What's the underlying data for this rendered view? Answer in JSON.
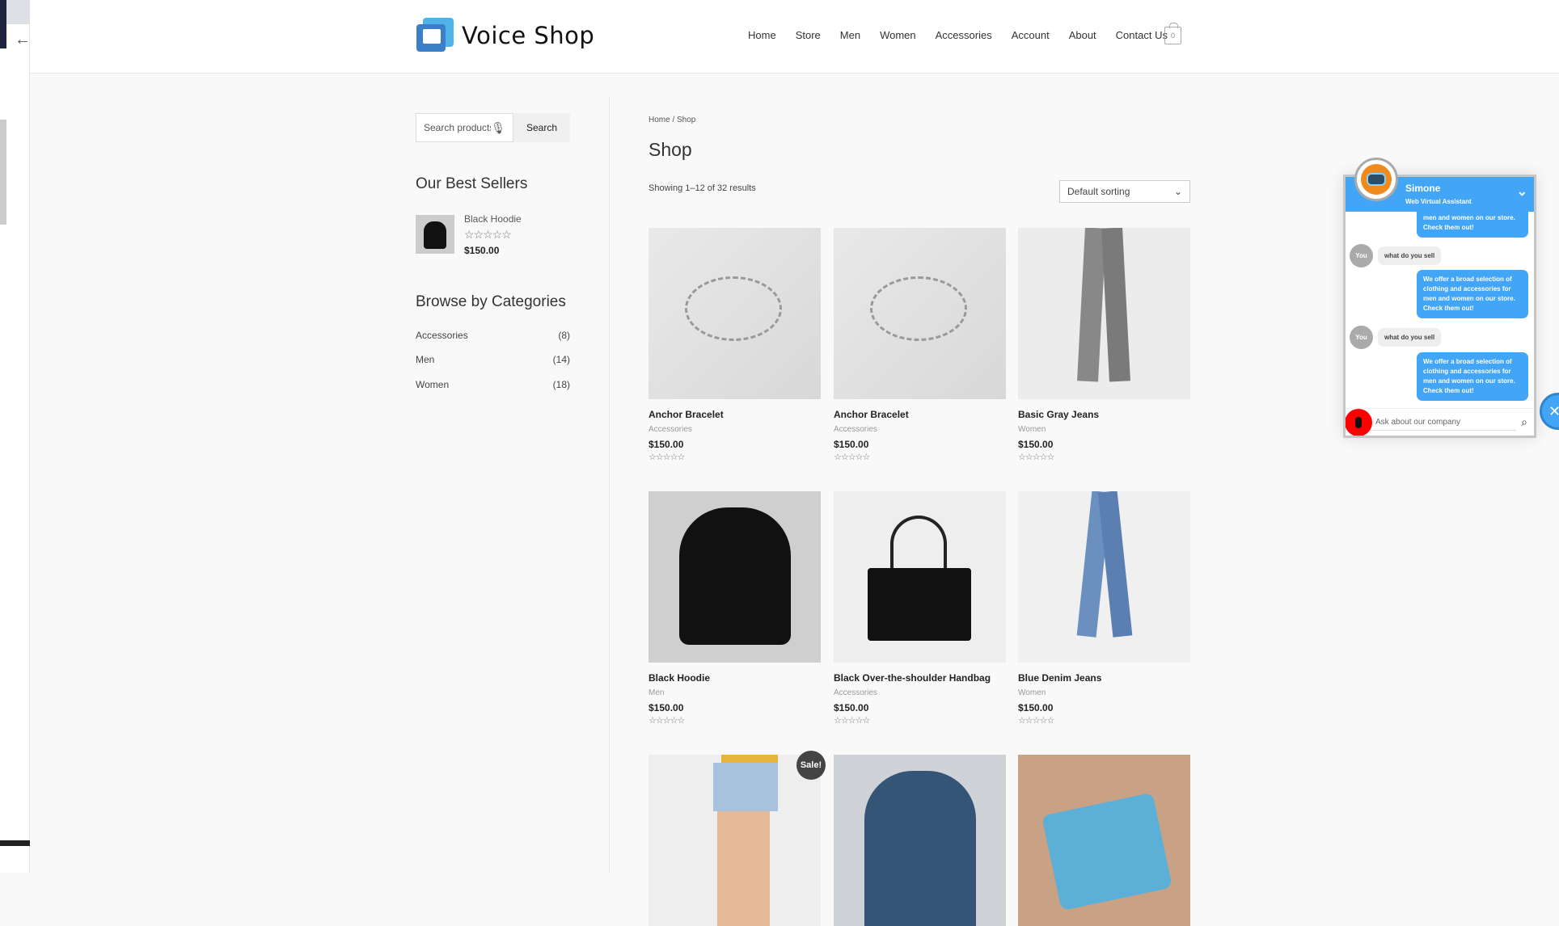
{
  "brand": {
    "name": "Voice Shop",
    "accent": "#42a5f5"
  },
  "nav": [
    "Home",
    "Store",
    "Men",
    "Women",
    "Accessories",
    "Account",
    "About",
    "Contact Us"
  ],
  "cart": {
    "count": "0"
  },
  "sidebar": {
    "search": {
      "placeholder": "Search products",
      "button": "Search"
    },
    "best_sellers_title": "Our Best Sellers",
    "best_seller": {
      "name": "Black Hoodie",
      "price": "$150.00",
      "rating": 0
    },
    "categories_title": "Browse by Categories",
    "categories": [
      {
        "name": "Accessories",
        "count": "(8)"
      },
      {
        "name": "Men",
        "count": "(14)"
      },
      {
        "name": "Women",
        "count": "(18)"
      }
    ]
  },
  "main": {
    "breadcrumb": "Home / Shop",
    "title": "Shop",
    "result_count": "Showing 1–12 of 32 results",
    "sort": "Default sorting",
    "sale_badge": "Sale!",
    "products": [
      {
        "name": "Anchor Bracelet",
        "category": "Accessories",
        "price": "$150.00"
      },
      {
        "name": "Anchor Bracelet",
        "category": "Accessories",
        "price": "$150.00"
      },
      {
        "name": "Basic Gray Jeans",
        "category": "Women",
        "price": "$150.00"
      },
      {
        "name": "Black Hoodie",
        "category": "Men",
        "price": "$150.00"
      },
      {
        "name": "Black Over-the-shoulder Handbag",
        "category": "Accessories",
        "price": "$150.00"
      },
      {
        "name": "Blue Denim Jeans",
        "category": "Women",
        "price": "$150.00"
      }
    ],
    "stars": "☆☆☆☆☆"
  },
  "chat": {
    "name": "Simone",
    "subtitle": "Web Virtual Assistant",
    "partial": "men and women on our store. Check them out!",
    "you": "You",
    "q": "what do you sell",
    "a": "We offer a broad selection of clothing and accessories for men and women on our store. Check them out!",
    "placeholder": "Ask about our company"
  }
}
